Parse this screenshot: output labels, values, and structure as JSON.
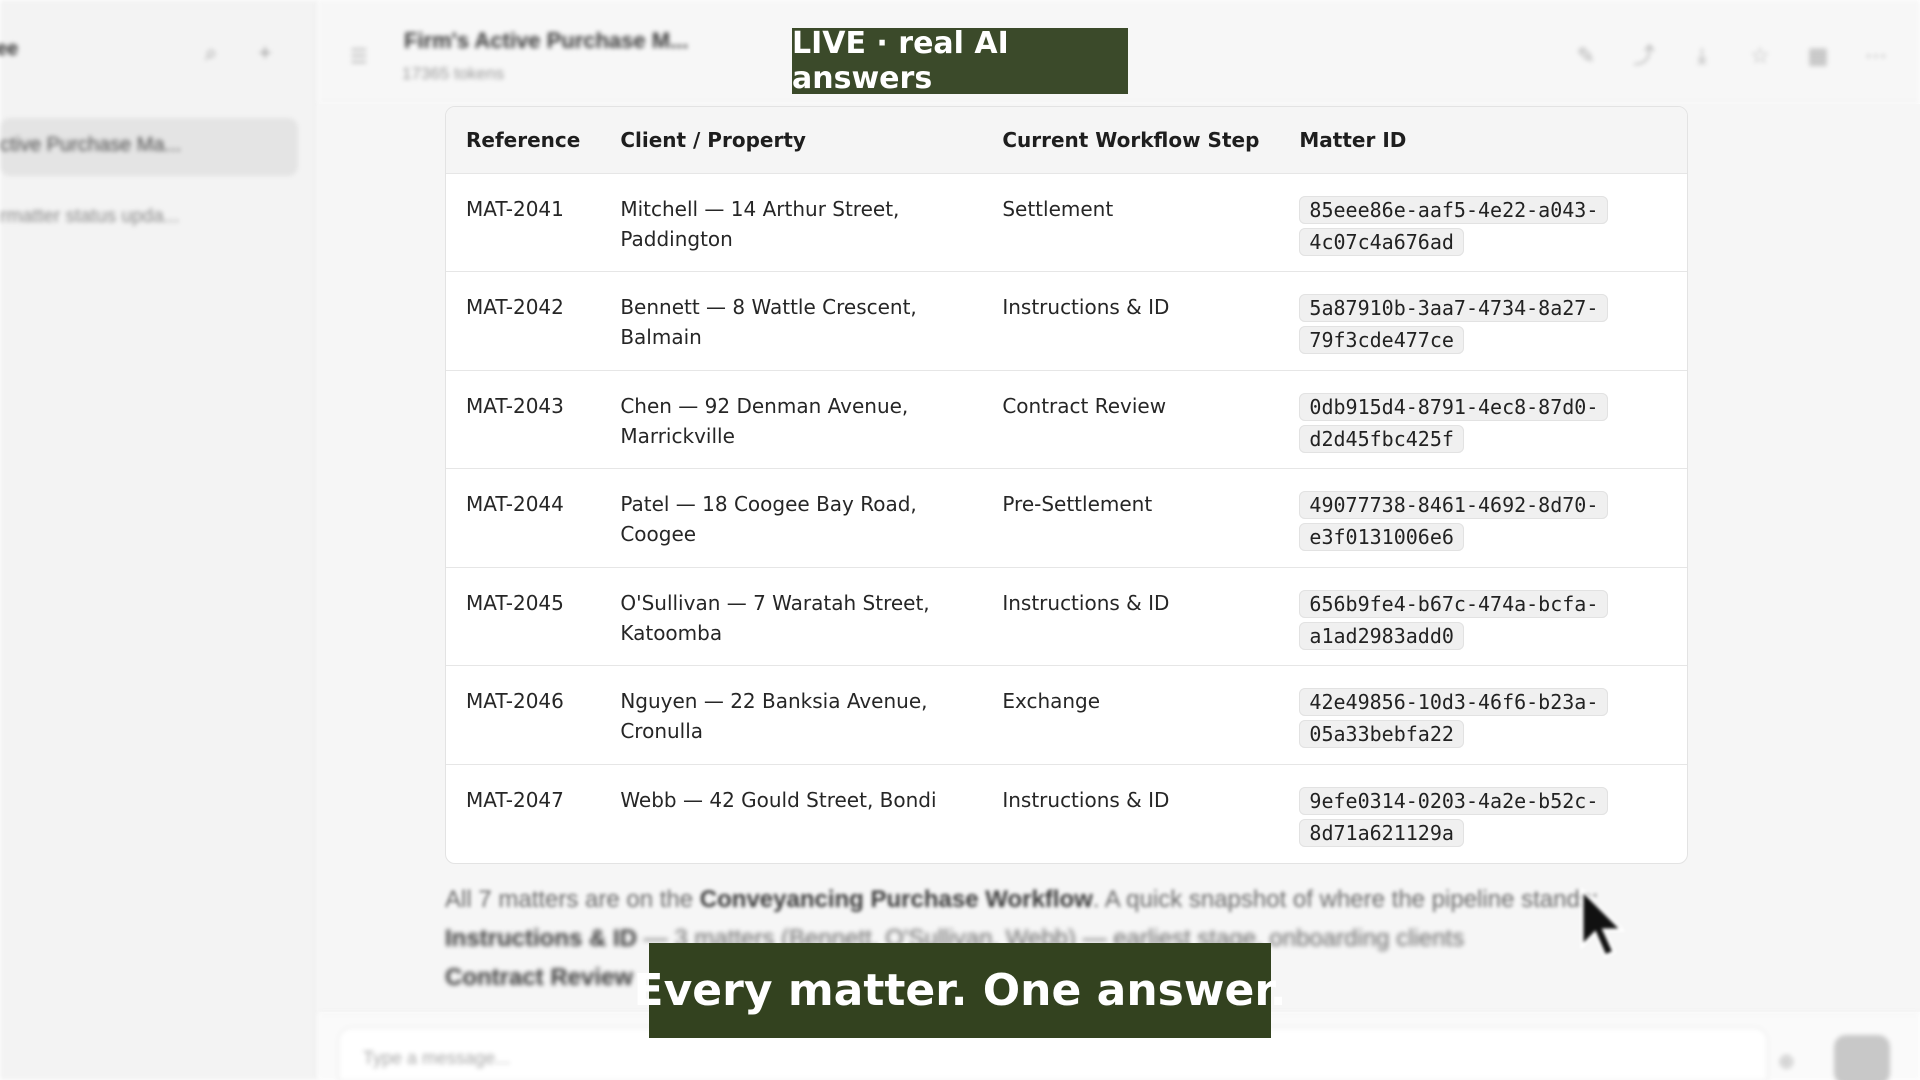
{
  "sidebar": {
    "title": "ee",
    "active_item": "ctive Purchase Ma...",
    "item": "rmatter status upda..."
  },
  "header": {
    "title": "Firm's Active Purchase M...",
    "tokens": "17365 tokens"
  },
  "table": {
    "headers": [
      "Reference",
      "Client / Property",
      "Current Workflow Step",
      "Matter ID"
    ],
    "rows": [
      {
        "reference": "MAT-2041",
        "client_property": "Mitchell — 14 Arthur Street, Paddington",
        "workflow_step": "Settlement",
        "matter_id": "85eee86e-aaf5-4e22-a043-4c07c4a676ad"
      },
      {
        "reference": "MAT-2042",
        "client_property": "Bennett — 8 Wattle Crescent, Balmain",
        "workflow_step": "Instructions & ID",
        "matter_id": "5a87910b-3aa7-4734-8a27-79f3cde477ce"
      },
      {
        "reference": "MAT-2043",
        "client_property": "Chen — 92 Denman Avenue, Marrickville",
        "workflow_step": "Contract Review",
        "matter_id": "0db915d4-8791-4ec8-87d0-d2d45fbc425f"
      },
      {
        "reference": "MAT-2044",
        "client_property": "Patel — 18 Coogee Bay Road, Coogee",
        "workflow_step": "Pre-Settlement",
        "matter_id": "49077738-8461-4692-8d70-e3f0131006e6"
      },
      {
        "reference": "MAT-2045",
        "client_property": "O'Sullivan — 7 Waratah Street, Katoomba",
        "workflow_step": "Instructions & ID",
        "matter_id": "656b9fe4-b67c-474a-bcfa-a1ad2983add0"
      },
      {
        "reference": "MAT-2046",
        "client_property": "Nguyen — 22 Banksia Avenue, Cronulla",
        "workflow_step": "Exchange",
        "matter_id": "42e49856-10d3-46f6-b23a-05a33bebfa22"
      },
      {
        "reference": "MAT-2047",
        "client_property": "Webb — 42 Gould Street, Bondi",
        "workflow_step": "Instructions & ID",
        "matter_id": "9efe0314-0203-4a2e-b52c-8d71a621129a"
      }
    ]
  },
  "summary": {
    "prefix": "All 7 matters are on the ",
    "workflow_name": "Conveyancing Purchase Workflow",
    "suffix": ". A quick snapshot of where the pipeline stands:",
    "line2_bold": "Instructions & ID",
    "line2_rest": " — 3 matters (Bennett, O'Sullivan, Webb) — earliest stage, onboarding clients",
    "line3_bold": "Contract Review"
  },
  "composer": {
    "placeholder": "Type a message..."
  },
  "overlay": {
    "live_badge": "LIVE · real AI answers",
    "caption": "Every matter. One answer."
  },
  "colors": {
    "badge_bg": "#3b4a2a",
    "caption_bg": "#33421f"
  }
}
